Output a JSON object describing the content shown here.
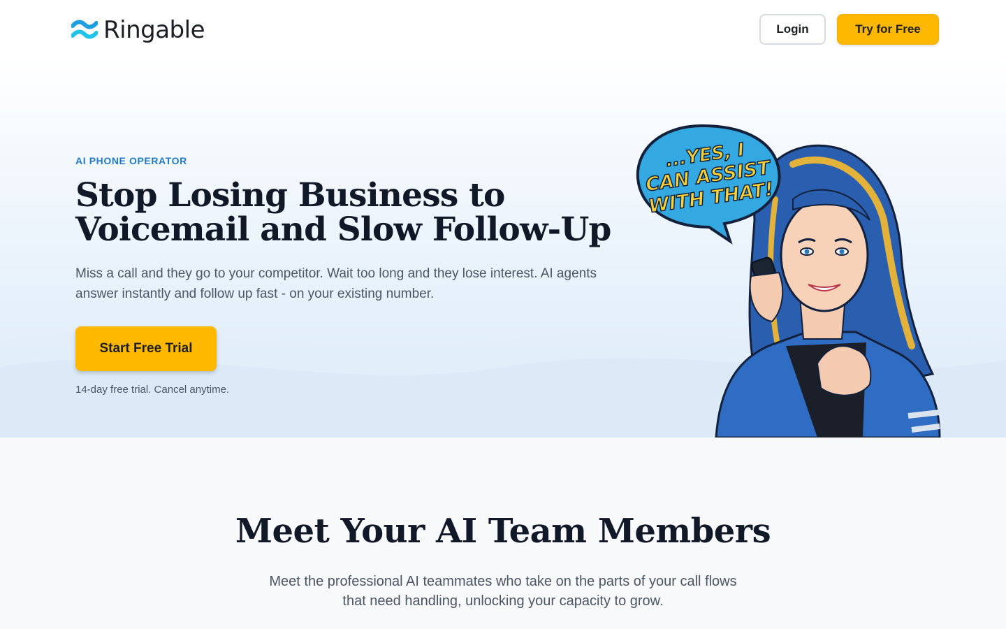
{
  "header": {
    "brand": "Ringable",
    "login_label": "Login",
    "try_label": "Try for Free"
  },
  "hero": {
    "eyebrow": "AI PHONE OPERATOR",
    "headline_line1": "Stop Losing Business to",
    "headline_line2": "Voicemail and Slow Follow-Up",
    "subtext": "Miss a call and they go to your competitor. Wait too long and they lose interest. AI agents answer instantly and follow up fast - on your existing number.",
    "cta_label": "Start Free Trial",
    "trial_note": "14-day free trial. Cancel anytime.",
    "speech_bubble_line1": "...YES, I",
    "speech_bubble_line2": "CAN ASSIST",
    "speech_bubble_line3": "WITH THAT!"
  },
  "team": {
    "title": "Meet Your AI Team Members",
    "subtitle": "Meet the professional AI teammates who take on the parts of your call flows that need handling, unlocking your capacity to grow."
  },
  "colors": {
    "accent": "#ffb800",
    "brand_blue": "#1f7bc5",
    "logo_cyan": "#22b8e8"
  },
  "icons": {
    "logo": "ringable-waves-logo-icon"
  }
}
